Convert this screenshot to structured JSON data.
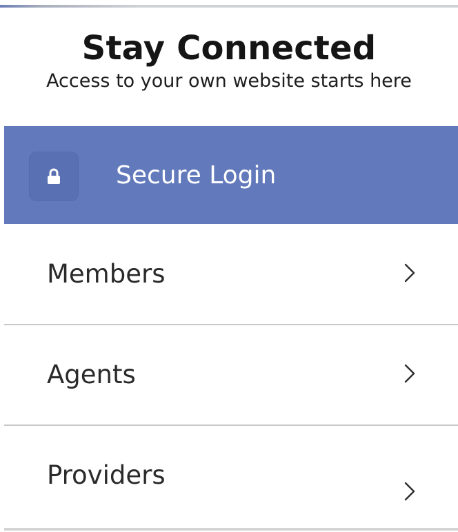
{
  "header": {
    "title": "Stay Connected",
    "subtitle": "Access to your own website starts here"
  },
  "login": {
    "label": "Secure Login",
    "icon": "lock-icon",
    "background_color": "#6279bb"
  },
  "menu": {
    "items": [
      {
        "label": "Members",
        "icon": "chevron-right-icon"
      },
      {
        "label": "Agents",
        "icon": "chevron-right-icon"
      },
      {
        "label": "Providers",
        "icon": "chevron-right-icon"
      }
    ]
  }
}
